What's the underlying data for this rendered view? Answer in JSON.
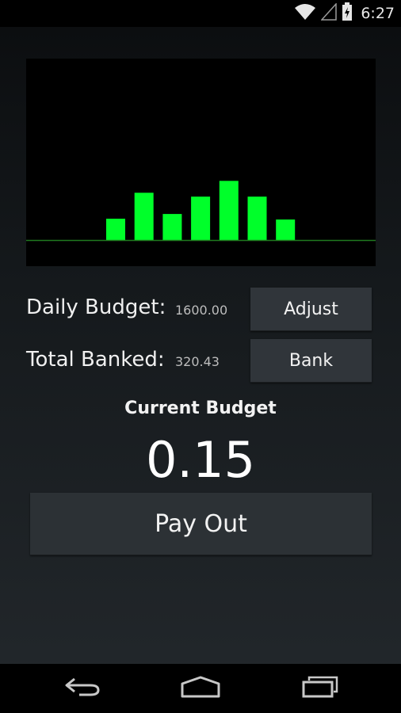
{
  "status_bar": {
    "time": "6:27",
    "icons": [
      "wifi-icon",
      "signal-icon",
      "battery-icon"
    ]
  },
  "chart_data": {
    "type": "bar",
    "values": [
      27,
      60,
      33,
      55,
      75,
      55,
      26
    ],
    "ylim": [
      0,
      230
    ],
    "bar_color": "#00ff2a",
    "baseline_color": "#1f7a1f",
    "background": "#000000"
  },
  "daily_budget": {
    "label": "Daily Budget:",
    "value": "1600.00",
    "button_label": "Adjust"
  },
  "total_banked": {
    "label": "Total Banked:",
    "value": "320.43",
    "button_label": "Bank"
  },
  "current_budget": {
    "title": "Current Budget",
    "value": "0.15"
  },
  "payout": {
    "button_label": "Pay Out"
  },
  "nav_bar": {
    "buttons": [
      "back-icon",
      "home-icon",
      "recent-apps-icon"
    ]
  },
  "colors": {
    "accent_green": "#00ff2a",
    "button_bg": "#30353a",
    "text": "#f0f0f0"
  }
}
